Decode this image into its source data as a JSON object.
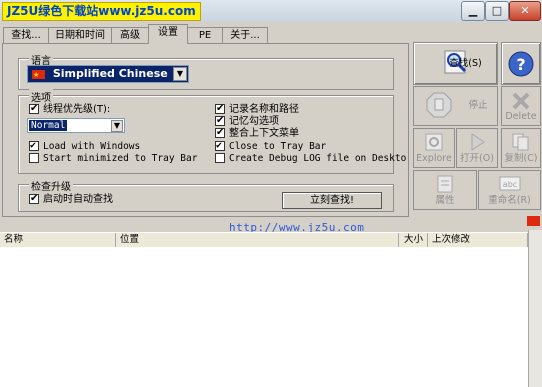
{
  "titlebar": {
    "brand": "JZ5U绿色下载站www.jz5u.com",
    "minimize": "▁",
    "maximize": "□",
    "close": "✕"
  },
  "tabs": [
    "查找...",
    "日期和时间",
    "高级",
    "设置",
    "PE",
    "关于..."
  ],
  "active_tab": "设置",
  "language": {
    "legend": "语言",
    "selected": "Simplified Chinese"
  },
  "options": {
    "legend": "选项",
    "thread_priority_label": "线程优先级(T):",
    "thread_priority_value": "Normal",
    "load_with_windows": "Load with Windows",
    "start_minimized": "Start minimized to Tray Bar",
    "record_name_path": "记录名称和路径",
    "remember_checked": "记忆勾选项",
    "combine_menu": "整合上下文菜单",
    "close_to_tray": "Close to Tray Bar",
    "debug_log": "Create Debug LOG file on Deskto"
  },
  "update": {
    "legend": "检查升级",
    "auto_check": "启动时自动查找",
    "check_now": "立刻查找!"
  },
  "actions": {
    "search": "查找(S)",
    "stop": "停止",
    "delete": "Delete",
    "explore": "Explore",
    "open": "打开(O)",
    "copy": "复制(C)",
    "properties": "属性",
    "rename": "重命名(R)"
  },
  "watermark": "http://www.jz5u.com",
  "columns": {
    "name": "名称",
    "location": "位置",
    "size": "大小",
    "modified": "上次修改"
  },
  "colors": {
    "panel": "#d4d0c8",
    "selection": "#0a246a",
    "brand_bg": "#fff200",
    "brand_text": "#0044cc"
  }
}
